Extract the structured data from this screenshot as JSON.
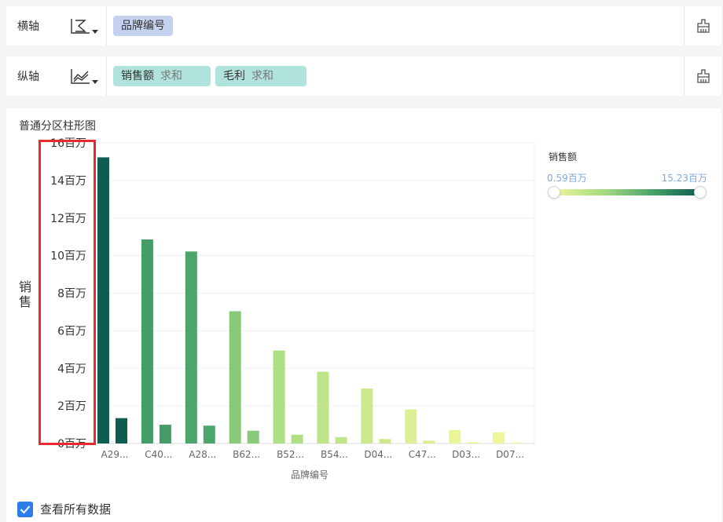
{
  "x_row": {
    "label": "横轴",
    "icon": "axis-x-icon",
    "field": "品牌编号"
  },
  "y_row": {
    "label": "纵轴",
    "icon": "axis-y-icon",
    "fields": [
      {
        "name": "销售额",
        "agg": "求和"
      },
      {
        "name": "毛利",
        "agg": "求和"
      }
    ]
  },
  "chart_title": "普通分区柱形图",
  "legend": {
    "title": "销售额",
    "min_label": "0.59百万",
    "max_label": "15.23百万",
    "colors": [
      "#eef59a",
      "#a7dc82",
      "#4aa56a",
      "#0f5c50"
    ]
  },
  "footer": {
    "checkbox_label": "查看所有数据",
    "checked": true
  },
  "chart_data": {
    "type": "bar",
    "title": "普通分区柱形图",
    "xlabel": "品牌编号",
    "ylabel": "销售",
    "ylim": [
      0,
      16000000
    ],
    "ticks": [
      0,
      2000000,
      4000000,
      6000000,
      8000000,
      10000000,
      12000000,
      14000000,
      16000000
    ],
    "tick_labels": [
      "0百万",
      "2百万",
      "4百万",
      "6百万",
      "8百万",
      "10百万",
      "12百万",
      "14百万",
      "16百万"
    ],
    "categories": [
      "A29...",
      "C40...",
      "A28...",
      "B62...",
      "B52...",
      "B54...",
      "D04...",
      "C47...",
      "D03...",
      "D07..."
    ],
    "series": [
      {
        "name": "销售额",
        "values": [
          15230000,
          10860000,
          10220000,
          7040000,
          4950000,
          3820000,
          2930000,
          1810000,
          720000,
          590000
        ]
      },
      {
        "name": "毛利",
        "values": [
          1350000,
          1000000,
          950000,
          680000,
          470000,
          340000,
          240000,
          150000,
          70000,
          50000
        ]
      }
    ],
    "legend_position": "top-right",
    "grid": true
  }
}
